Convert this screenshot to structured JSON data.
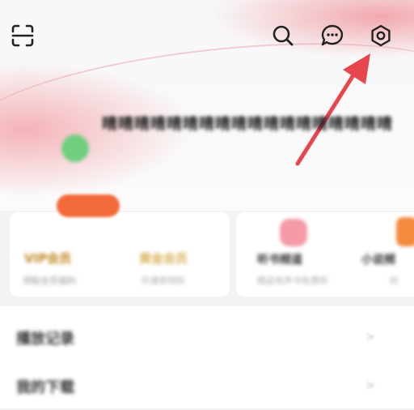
{
  "header": {
    "icons": [
      "scan-icon",
      "search-icon",
      "message-icon",
      "settings-gear-icon"
    ],
    "nickname": "晴晴晴晴晴晴晴晴晴晴晴晴晴晴晴晴晴晴",
    "accent_color": "#f26a3a"
  },
  "annotation": {
    "arrow_color": "#e8464e"
  },
  "vip_card": {
    "vip_title": "VIP会员",
    "vip_subtitle": "领取会员福利",
    "gold_title": "黄金会员",
    "gold_subtitle": "开通享特权"
  },
  "side_cards": [
    {
      "title": "听书频道",
      "subtitle": "精品有声书免费听"
    },
    {
      "title": "小说频",
      "subtitle": "好"
    }
  ],
  "list": {
    "rows": [
      {
        "label": "播放记录"
      },
      {
        "label": "我的下载"
      }
    ]
  }
}
